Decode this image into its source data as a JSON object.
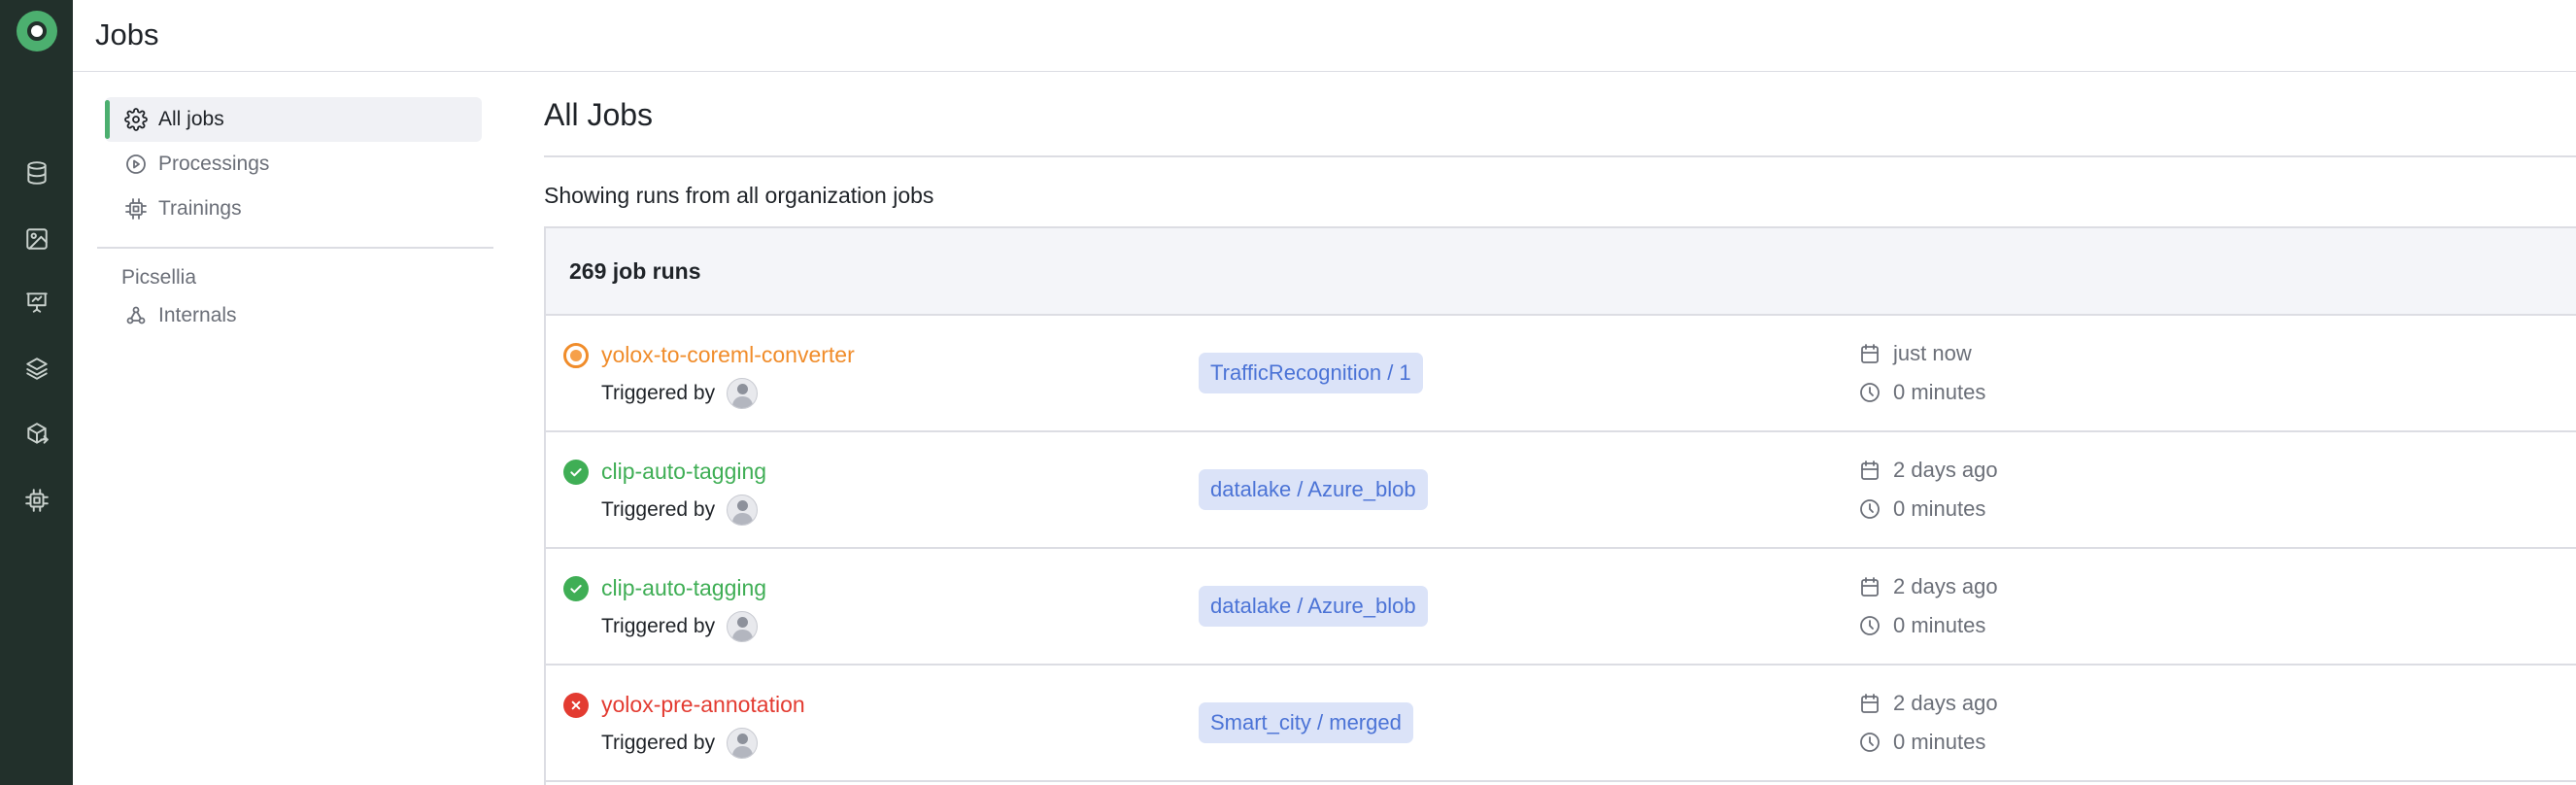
{
  "header": {
    "title": "Jobs"
  },
  "rail": {
    "icons": [
      "database-icon",
      "image-icon",
      "presentation-icon",
      "layers-icon",
      "package-export-icon",
      "cpu-icon"
    ]
  },
  "sidebar": {
    "items": [
      {
        "label": "All jobs",
        "icon": "gear-icon",
        "active": true
      },
      {
        "label": "Processings",
        "icon": "play-circle-icon",
        "active": false
      },
      {
        "label": "Trainings",
        "icon": "cpu-icon",
        "active": false
      }
    ],
    "section_title": "Picsellia",
    "section_items": [
      {
        "label": "Internals",
        "icon": "webhook-icon"
      }
    ]
  },
  "main": {
    "title": "All Jobs",
    "subtitle": "Showing runs from all organization jobs",
    "panel_title": "269 job runs",
    "rows": [
      {
        "status": "running",
        "name": "yolox-to-coreml-converter",
        "triggered_label": "Triggered by",
        "dataset": "TrafficRecognition / 1",
        "date": "just now",
        "duration": "0 minutes"
      },
      {
        "status": "success",
        "name": "clip-auto-tagging",
        "triggered_label": "Triggered by",
        "dataset": "datalake / Azure_blob",
        "date": "2 days ago",
        "duration": "0 minutes"
      },
      {
        "status": "success",
        "name": "clip-auto-tagging",
        "triggered_label": "Triggered by",
        "dataset": "datalake / Azure_blob",
        "date": "2 days ago",
        "duration": "0 minutes"
      },
      {
        "status": "failed",
        "name": "yolox-pre-annotation",
        "triggered_label": "Triggered by",
        "dataset": "Smart_city / merged",
        "date": "2 days ago",
        "duration": "0 minutes"
      }
    ]
  },
  "colors": {
    "accent": "#4caf6f",
    "rail_bg": "#22302b",
    "success": "#3fae55",
    "failed": "#e33b31",
    "running": "#f08c2a",
    "tag_bg": "#dbe3f8",
    "tag_text": "#4b73d6"
  }
}
